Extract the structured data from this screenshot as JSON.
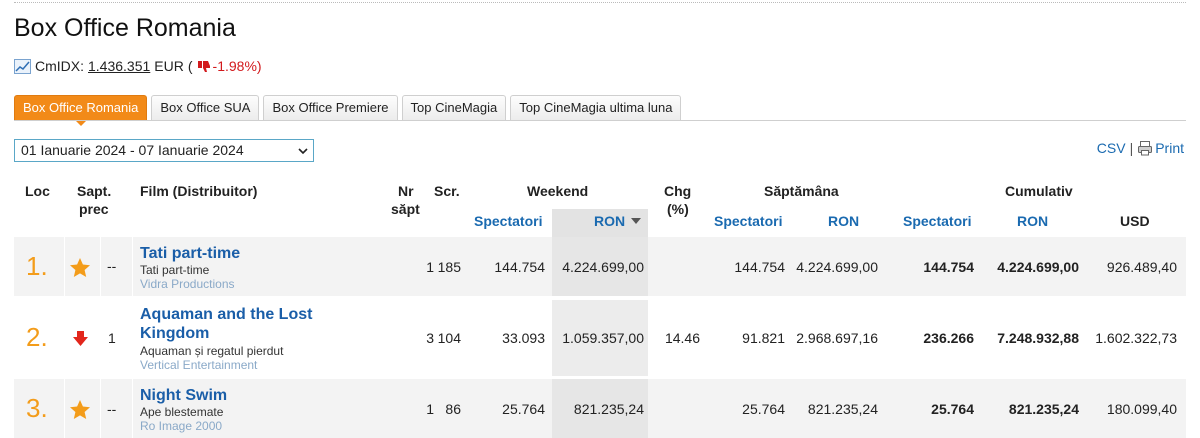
{
  "page": {
    "title": "Box Office Romania"
  },
  "cmidx": {
    "label": "CmIDX:",
    "value": "1.436.351",
    "currency": "EUR",
    "open": "(",
    "change": "-1.98%)"
  },
  "tabs": [
    {
      "label": "Box Office Romania",
      "active": true
    },
    {
      "label": "Box Office SUA"
    },
    {
      "label": "Box Office Premiere"
    },
    {
      "label": "Top CineMagia"
    },
    {
      "label": "Top CineMagia ultima luna"
    }
  ],
  "period_select": {
    "value": "01 Ianuarie 2024 - 07 Ianuarie 2024"
  },
  "export": {
    "csv": "CSV",
    "sep": "|",
    "print": "Print"
  },
  "table": {
    "headers": {
      "loc": "Loc",
      "prev_week_1": "Sapt.",
      "prev_week_2": "prec",
      "film": "Film (Distribuitor)",
      "weeks_1": "Nr",
      "weeks_2": "săpt",
      "screens": "Scr.",
      "weekend": "Weekend",
      "chg_1": "Chg",
      "chg_2": "(%)",
      "week": "Săptămâna",
      "cumulative": "Cumulativ",
      "spectators": "Spectatori",
      "ron": "RON",
      "usd": "USD"
    },
    "rows": [
      {
        "rank": "1.",
        "trend": "new",
        "prev": "--",
        "title": "Tati part-time",
        "alt_title": "Tati part-time",
        "distributor": "Vidra Productions",
        "weeks": "1",
        "screens": "185",
        "we_spect": "144.754",
        "we_ron": "4.224.699,00",
        "chg": "",
        "wk_spect": "144.754",
        "wk_ron": "4.224.699,00",
        "cum_spect": "144.754",
        "cum_ron": "4.224.699,00",
        "cum_usd": "926.489,40"
      },
      {
        "rank": "2.",
        "trend": "down",
        "prev": "1",
        "title": "Aquaman and the Lost Kingdom",
        "title_l1": "Aquaman and the Lost",
        "title_l2": "Kingdom",
        "alt_title": "Aquaman și regatul pierdut",
        "distributor": "Vertical Entertainment",
        "weeks": "3",
        "screens": "104",
        "we_spect": "33.093",
        "we_ron": "1.059.357,00",
        "chg": "14.46",
        "wk_spect": "91.821",
        "wk_ron": "2.968.697,16",
        "cum_spect": "236.266",
        "cum_ron": "7.248.932,88",
        "cum_usd": "1.602.322,73"
      },
      {
        "rank": "3.",
        "trend": "new",
        "prev": "--",
        "title": "Night Swim",
        "alt_title": "Ape blestemate",
        "distributor": "Ro Image 2000",
        "weeks": "1",
        "screens": "86",
        "we_spect": "25.764",
        "we_ron": "821.235,24",
        "chg": "",
        "wk_spect": "25.764",
        "wk_ron": "821.235,24",
        "cum_spect": "25.764",
        "cum_ron": "821.235,24",
        "cum_usd": "180.099,40"
      }
    ]
  },
  "colors": {
    "accent": "#f28a18",
    "link": "#1a5ea8",
    "negative": "#d2191c",
    "rank": "#f39c1a"
  },
  "icons": {
    "chart": "chart-icon",
    "thumbs_down": "thumbs-down-icon",
    "new": "star-icon",
    "down": "arrow-down-icon",
    "print": "printer-icon"
  }
}
